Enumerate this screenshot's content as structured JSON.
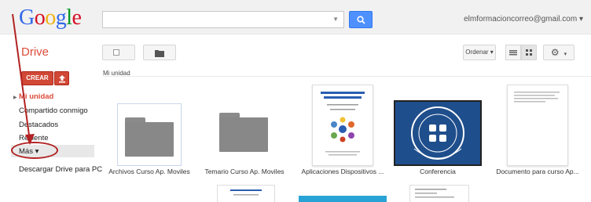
{
  "header": {
    "logo_letters": [
      "G",
      "o",
      "o",
      "g",
      "l",
      "e"
    ],
    "logo_colors": [
      "#3369e8",
      "#d50f25",
      "#eeb211",
      "#3369e8",
      "#009925",
      "#d50f25"
    ],
    "account": "elmformacioncorreo@gmail.com ▾",
    "search_value": ""
  },
  "sidebar": {
    "title": "Drive",
    "create_label": "CREAR",
    "items": [
      {
        "label": "Mi unidad"
      },
      {
        "label": "Compartido conmigo"
      },
      {
        "label": "Destacados"
      },
      {
        "label": "Reciente"
      },
      {
        "label": "Más ▾"
      },
      {
        "label": "Descargar Drive para PC"
      }
    ]
  },
  "toolbar": {
    "sort_label": "Ordenar ▾",
    "breadcrumb": "Mi unidad"
  },
  "files": [
    {
      "name": "Archivos Curso Ap. Moviles",
      "kind": "folder"
    },
    {
      "name": "Temario Curso Ap. Moviles",
      "kind": "folder"
    },
    {
      "name": "Aplicaciones Dispositivos ...",
      "kind": "document"
    },
    {
      "name": "Conferencia",
      "kind": "image"
    },
    {
      "name": "Documento para curso Ap...",
      "kind": "document"
    }
  ],
  "colors": {
    "accent": "#dd4b39",
    "search_button": "#4d90fe",
    "annotation": "#b22222"
  }
}
